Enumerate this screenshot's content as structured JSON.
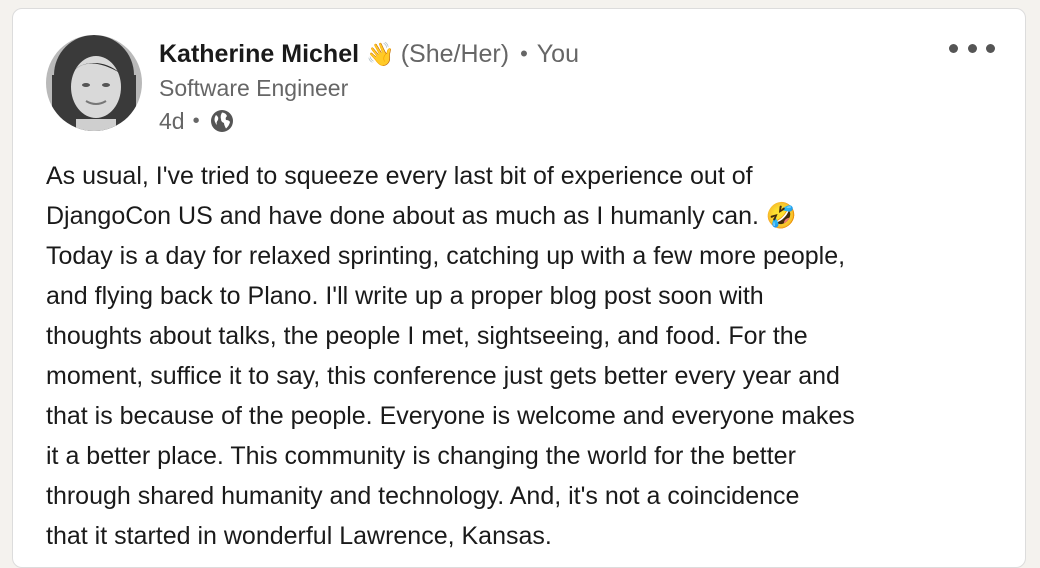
{
  "author": {
    "name": "Katherine Michel",
    "emoji": "👋",
    "pronouns": "(She/Her)",
    "separator": "•",
    "connection": "You",
    "headline": "Software Engineer",
    "time": "4d",
    "visibility_icon": "globe-icon"
  },
  "menu": {
    "icon": "more-options-icon"
  },
  "post": {
    "lines": [
      "As usual, I've tried to squeeze every last bit of experience out of",
      "DjangoCon US and have done about as much as I humanly can. 🤣",
      "Today is a day for relaxed sprinting, catching up with a few more people,",
      "and flying back to Plano. I'll write up a proper blog post soon with",
      "thoughts about talks, the people I met, sightseeing, and food. For the",
      "moment, suffice it to say, this conference just gets better every year and",
      "that is because of the people. Everyone is welcome and everyone makes",
      "it a better place. This community is changing the world for the better",
      "through shared humanity and technology. And, it's not a coincidence",
      "that it started in wonderful Lawrence, Kansas."
    ]
  }
}
